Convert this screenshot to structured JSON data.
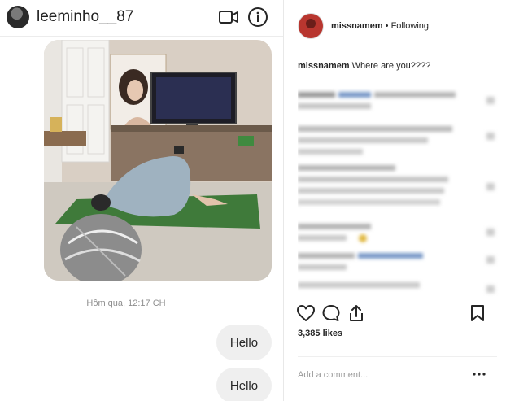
{
  "dm": {
    "username": "leeminho__87",
    "timestamp": "Hôm qua, 12:17 CH",
    "messages": [
      "Hello",
      "Hello"
    ]
  },
  "post": {
    "username": "missnamem",
    "separator": "•",
    "follow_status": "Following",
    "caption_user": "missnamem",
    "caption_text": "Where are you????",
    "likes": "3,385 likes",
    "comment_placeholder": "Add a comment..."
  },
  "colors": {
    "wall": "#d9cfc4",
    "yoga_mat": "#3f7a3a",
    "floor": "#cfc9c0"
  }
}
